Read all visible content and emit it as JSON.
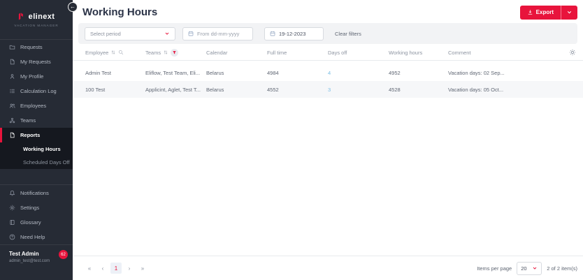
{
  "colors": {
    "accent_red": "#e8143c",
    "sidebar_bg": "#262b35",
    "link_blue": "#79bde4"
  },
  "sidebar": {
    "logo": {
      "brand": "elinext",
      "subtitle": "VACATION MANAGER"
    },
    "collapse_icon": "←",
    "items": [
      {
        "label": "Requests",
        "icon": "folder-icon"
      },
      {
        "label": "My Requests",
        "icon": "document-icon"
      },
      {
        "label": "My Profile",
        "icon": "person-icon"
      },
      {
        "label": "Calculation Log",
        "icon": "list-icon"
      },
      {
        "label": "Employees",
        "icon": "people-icon"
      },
      {
        "label": "Teams",
        "icon": "team-icon"
      },
      {
        "label": "Reports",
        "icon": "report-icon",
        "active": true
      }
    ],
    "sub_items": [
      {
        "label": "Working Hours",
        "active": true
      },
      {
        "label": "Scheduled Days Off",
        "active": false
      }
    ],
    "footer_items": [
      {
        "label": "Notifications",
        "icon": "bell-icon"
      },
      {
        "label": "Settings",
        "icon": "gear-icon"
      },
      {
        "label": "Glossary",
        "icon": "book-icon"
      },
      {
        "label": "Need Help",
        "icon": "help-icon"
      }
    ],
    "user": {
      "name": "Test Admin",
      "email": "admin_test@test.com",
      "badge": "62"
    }
  },
  "header": {
    "title": "Working Hours",
    "export_label": "Export"
  },
  "filters": {
    "period_placeholder": "Select period",
    "from_placeholder": "From dd-mm-yyyy",
    "to_value": "19-12-2023",
    "clear_label": "Clear filters"
  },
  "table": {
    "columns": [
      "Employee",
      "Teams",
      "Calendar",
      "Full time",
      "Days off",
      "Working hours",
      "Comment"
    ],
    "rows": [
      {
        "employee": "Admin Test",
        "teams": "Eliflow, Test Team, Eli...",
        "calendar": "Belarus",
        "full_time": "4984",
        "days_off": "4",
        "working_hours": "4952",
        "comment": "Vacation days: 02 Sep..."
      },
      {
        "employee": "100 Test",
        "teams": "Applicint, Aglet, Test T...",
        "calendar": "Belarus",
        "full_time": "4552",
        "days_off": "3",
        "working_hours": "4528",
        "comment": "Vacation days: 05 Oct..."
      }
    ]
  },
  "pagination": {
    "first": "«",
    "prev": "‹",
    "current_page": "1",
    "next": "›",
    "last": "»",
    "items_per_page_label": "Items per page",
    "items_per_page_value": "20",
    "summary": "2 of 2 item(s)"
  }
}
